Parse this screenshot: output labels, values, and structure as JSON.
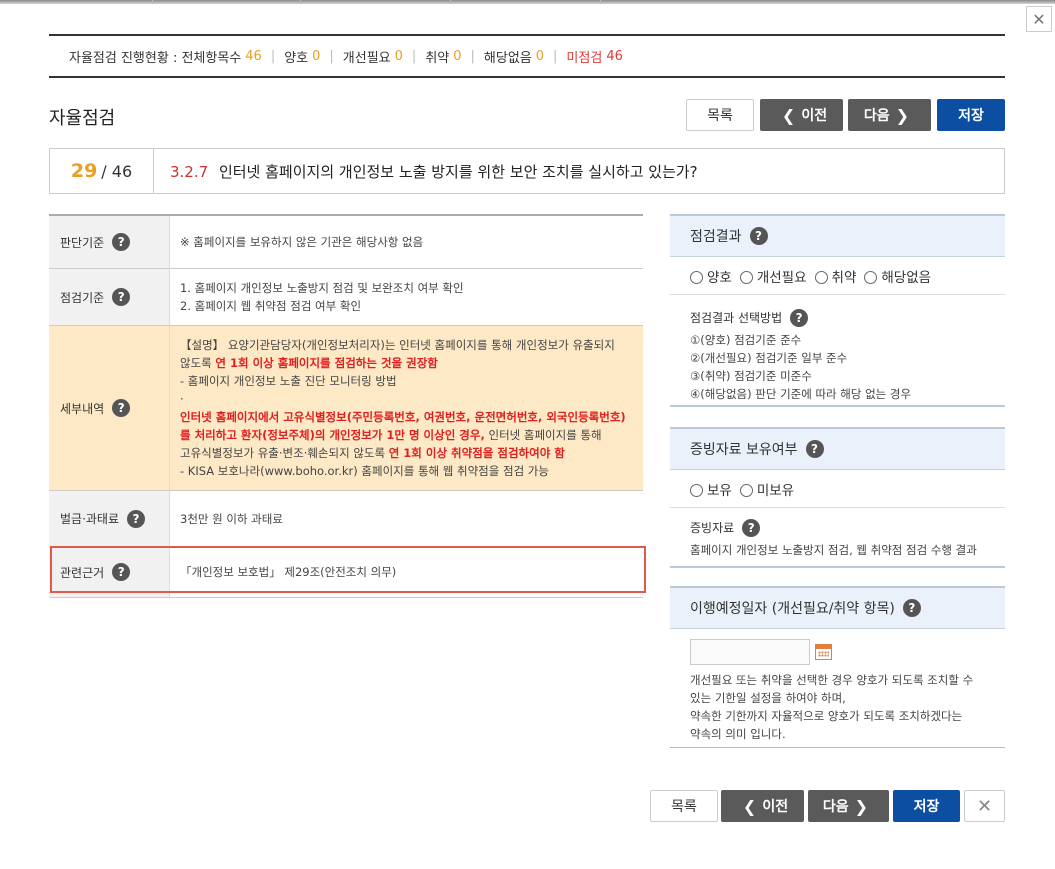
{
  "status": {
    "label": "자율점검 진행현황 : 전체항목수",
    "total": "46",
    "good_label": "양호",
    "good": "0",
    "improve_label": "개선필요",
    "improve": "0",
    "weak_label": "취약",
    "weak": "0",
    "na_label": "해당없음",
    "na": "0",
    "unchecked_label": "미점검",
    "unchecked": "46"
  },
  "section_title": "자율점검",
  "buttons": {
    "list": "목록",
    "prev": "이전",
    "next": "다음",
    "save": "저장",
    "close": "✕"
  },
  "question": {
    "current": "29",
    "total": "/ 46",
    "number": "3.2.7",
    "text": "인터넷 홈페이지의 개인정보 노출 방지를 위한 보안 조치를 실시하고 있는가?"
  },
  "rows": {
    "criteria": {
      "label": "판단기준",
      "text": "※ 홈페이지를 보유하지 않은 기관은 해당사항 없음"
    },
    "check": {
      "label": "점검기준",
      "line1": "1. 홈페이지 개인정보 노출방지 점검 및 보완조치 여부 확인",
      "line2": "2. 홈페이지 웹 취약점 점검 여부 확인"
    },
    "detail": {
      "label": "세부내역",
      "l1": "【설명】 요양기관담당자(개인정보처리자)는 인터넷 홈페이지를 통해 개인정보가 유출되지",
      "l2a": "않도록 ",
      "l2b": "연 1회 이상 홈페이지를 점검하는 것을 권장함",
      "l3": "- 홈페이지 개인정보 노출 진단 모니터링 방법",
      "l4": "·",
      "l5": "인터넷 홈페이지에서 고유식별정보(주민등록번호, 여권번호, 운전면허번호, 외국인등록번호)",
      "l6a": "를 처리하고 환자(정보주체)의 개인정보가 1만 명 이상인 경우,",
      "l6b": " 인터넷 홈페이지를 통해",
      "l7a": "고유식별정보가 유출·변조·훼손되지 않도록 ",
      "l7b": "연 1회 이상 취약점을 점검하여야 함",
      "l8": "- KISA 보호나라(www.boho.or.kr) 홈페이지를 통해 웹 취약점을 점검 가능"
    },
    "penalty": {
      "label": "벌금·과태료",
      "text": "3천만 원 이하 과태료"
    },
    "basis": {
      "label": "관련근거",
      "text": "「개인정보 보호법」 제29조(안전조치 의무)"
    }
  },
  "right": {
    "result_head": "점검결과",
    "options": [
      "양호",
      "개선필요",
      "취약",
      "해당없음"
    ],
    "method_title": "점검결과 선택방법",
    "method_lines": [
      "①(양호) 점검기준 준수",
      "②(개선필요) 점검기준 일부 준수",
      "③(취약) 점검기준 미준수",
      "④(해당없음) 판단 기준에 따라 해당 없는 경우"
    ],
    "evidence_head": "증빙자료 보유여부",
    "evidence_options": [
      "보유",
      "미보유"
    ],
    "evidence_title": "증빙자료",
    "evidence_text": "홈페이지 개인정보 노출방지 점검, 웹 취약점 점검 수행 결과",
    "date_head": "이행예정일자 (개선필요/취약 항목)",
    "date_lines": [
      "개선필요 또는 취약을 선택한 경우 양호가 되도록 조치할 수",
      "있는 기한일 설정을 하여야 하며,",
      "약속한 기한까지 자율적으로 양호가 되도록 조치하겠다는",
      "약속의 의미 입니다."
    ]
  }
}
